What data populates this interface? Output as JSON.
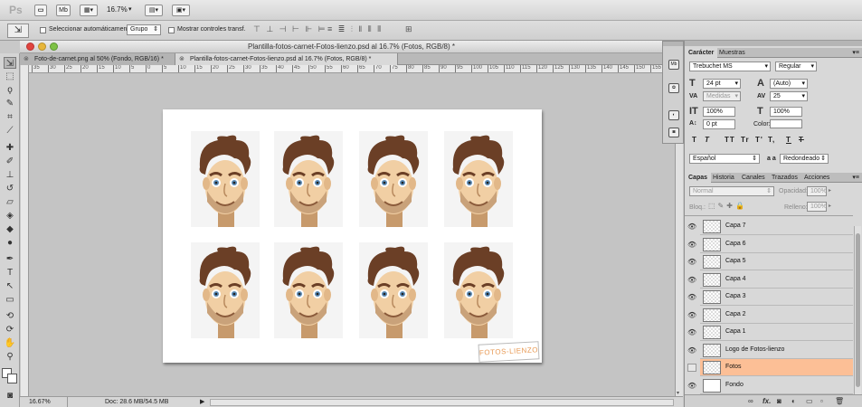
{
  "app": {
    "logo": "Ps"
  },
  "menubar": {
    "mb_label": "Mb",
    "zoom": "16.7%"
  },
  "options": {
    "auto_select_label": "Seleccionar automáticamente:",
    "auto_select_value": "Grupo",
    "show_transform_label": "Mostrar controles transf."
  },
  "window": {
    "title": "Plantilla-fotos-carnet-Fotos-lienzo.psd al 16.7% (Fotos, RGB/8) *"
  },
  "doc_tabs": [
    {
      "label": "Foto-de-carnet.png al 50% (Fondo, RGB/16) *"
    },
    {
      "label": "Plantilla-fotos-carnet-Fotos-lienzo.psd al 16.7% (Fotos, RGB/8) *"
    }
  ],
  "rulers": {
    "h_ticks": [
      "35",
      "30",
      "25",
      "20",
      "15",
      "10",
      "5",
      "0",
      "5",
      "10",
      "15",
      "20",
      "25",
      "30",
      "35",
      "40",
      "45",
      "50",
      "55",
      "60",
      "65",
      "70",
      "75",
      "80",
      "85",
      "90",
      "95",
      "100",
      "105",
      "110",
      "115",
      "120",
      "125",
      "130",
      "135",
      "140",
      "145",
      "150",
      "155",
      "160"
    ]
  },
  "canvas": {
    "logo_text": "FOTOS-LIENZO"
  },
  "status": {
    "zoom": "16.67%",
    "doc_info": "Doc: 28.6 MB/54.5 MB"
  },
  "character_panel": {
    "tabs": [
      "Carácter",
      "Muestras"
    ],
    "font_family": "Trebuchet MS",
    "font_style": "Regular",
    "font_size": "24 pt",
    "leading": "(Auto)",
    "kerning": "Medidas",
    "tracking": "25",
    "vertical_scale": "100%",
    "horizontal_scale": "100%",
    "baseline_shift": "0 pt",
    "color_label": "Color:",
    "style_buttons": [
      "T",
      "T",
      "TT",
      "Tr",
      "T'",
      "T,",
      "T",
      "T"
    ],
    "language": "Español",
    "aa_label": "a a",
    "antialias": "Redondeado"
  },
  "layers_panel": {
    "tabs": [
      "Capas",
      "Historia",
      "Canales",
      "Trazados",
      "Acciones"
    ],
    "blend_mode": "Normal",
    "opacity_label": "Opacidad:",
    "opacity": "100%",
    "lock_label": "Bloq.:",
    "fill_label": "Relleno:",
    "fill": "100%",
    "layers": [
      {
        "name": "Capa 7",
        "visible": true,
        "selected": false
      },
      {
        "name": "Capa 6",
        "visible": true,
        "selected": false
      },
      {
        "name": "Capa 5",
        "visible": true,
        "selected": false
      },
      {
        "name": "Capa 4",
        "visible": true,
        "selected": false
      },
      {
        "name": "Capa 3",
        "visible": true,
        "selected": false
      },
      {
        "name": "Capa 2",
        "visible": true,
        "selected": false
      },
      {
        "name": "Capa 1",
        "visible": true,
        "selected": false
      },
      {
        "name": "Logo de Fotos-lienzo",
        "visible": true,
        "selected": false
      },
      {
        "name": "Fotos",
        "visible": false,
        "selected": true
      },
      {
        "name": "Fondo",
        "visible": true,
        "selected": false
      }
    ],
    "footer_fx": "fx."
  },
  "colors": {
    "selected_layer": "#fcbf96",
    "hair": "#6b3f26",
    "skin": "#f1cfa4",
    "logo": "#e89a55"
  }
}
